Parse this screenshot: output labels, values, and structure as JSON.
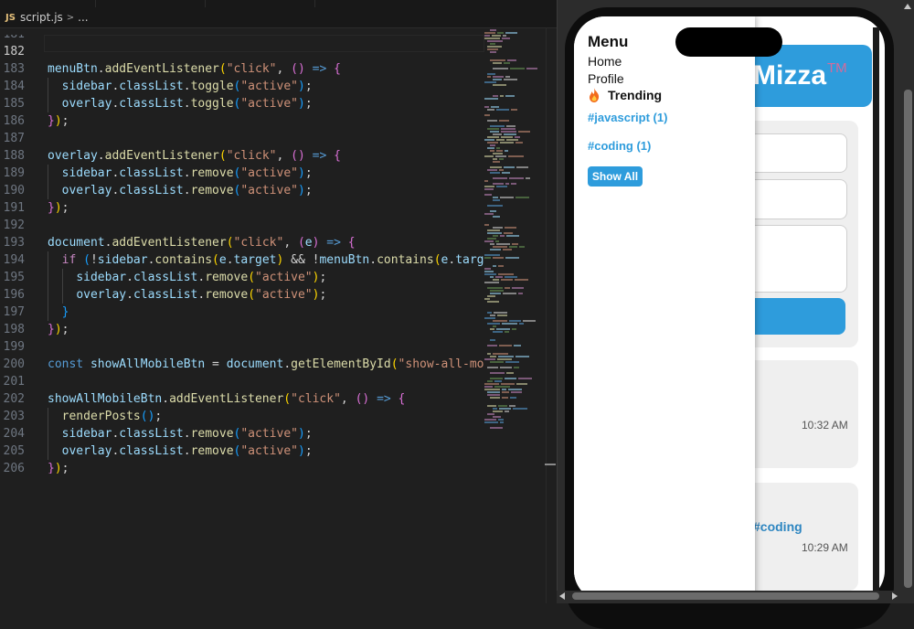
{
  "editor": {
    "file_badge": "JS",
    "file_name": "script.js",
    "crumb_sep": ">",
    "crumb_more": "...",
    "current_line": "182",
    "lines": [
      {
        "n": "181",
        "t": []
      },
      {
        "n": "182",
        "t": []
      },
      {
        "n": "183",
        "t": [
          [
            "var",
            "menuBtn"
          ],
          [
            "p",
            "."
          ],
          [
            "fn",
            "addEventListener"
          ],
          [
            "b1",
            "("
          ],
          [
            "str",
            "\"click\""
          ],
          [
            "p",
            ", "
          ],
          [
            "b2",
            "()"
          ],
          [
            "p",
            " "
          ],
          [
            "kw",
            "=>"
          ],
          [
            "p",
            " "
          ],
          [
            "b2",
            "{"
          ]
        ]
      },
      {
        "n": "184",
        "t": [
          [
            "p",
            "  "
          ],
          [
            "var",
            "sidebar"
          ],
          [
            "p",
            "."
          ],
          [
            "var",
            "classList"
          ],
          [
            "p",
            "."
          ],
          [
            "fn",
            "toggle"
          ],
          [
            "b3",
            "("
          ],
          [
            "str",
            "\"active\""
          ],
          [
            "b3",
            ")"
          ],
          [
            "p",
            ";"
          ]
        ]
      },
      {
        "n": "185",
        "t": [
          [
            "p",
            "  "
          ],
          [
            "var",
            "overlay"
          ],
          [
            "p",
            "."
          ],
          [
            "var",
            "classList"
          ],
          [
            "p",
            "."
          ],
          [
            "fn",
            "toggle"
          ],
          [
            "b3",
            "("
          ],
          [
            "str",
            "\"active\""
          ],
          [
            "b3",
            ")"
          ],
          [
            "p",
            ";"
          ]
        ]
      },
      {
        "n": "186",
        "t": [
          [
            "b2",
            "}"
          ],
          [
            "b1",
            ")"
          ],
          [
            "p",
            ";"
          ]
        ]
      },
      {
        "n": "187",
        "t": []
      },
      {
        "n": "188",
        "t": [
          [
            "var",
            "overlay"
          ],
          [
            "p",
            "."
          ],
          [
            "fn",
            "addEventListener"
          ],
          [
            "b1",
            "("
          ],
          [
            "str",
            "\"click\""
          ],
          [
            "p",
            ", "
          ],
          [
            "b2",
            "()"
          ],
          [
            "p",
            " "
          ],
          [
            "kw",
            "=>"
          ],
          [
            "p",
            " "
          ],
          [
            "b2",
            "{"
          ]
        ]
      },
      {
        "n": "189",
        "t": [
          [
            "p",
            "  "
          ],
          [
            "var",
            "sidebar"
          ],
          [
            "p",
            "."
          ],
          [
            "var",
            "classList"
          ],
          [
            "p",
            "."
          ],
          [
            "fn",
            "remove"
          ],
          [
            "b3",
            "("
          ],
          [
            "str",
            "\"active\""
          ],
          [
            "b3",
            ")"
          ],
          [
            "p",
            ";"
          ]
        ]
      },
      {
        "n": "190",
        "t": [
          [
            "p",
            "  "
          ],
          [
            "var",
            "overlay"
          ],
          [
            "p",
            "."
          ],
          [
            "var",
            "classList"
          ],
          [
            "p",
            "."
          ],
          [
            "fn",
            "remove"
          ],
          [
            "b3",
            "("
          ],
          [
            "str",
            "\"active\""
          ],
          [
            "b3",
            ")"
          ],
          [
            "p",
            ";"
          ]
        ]
      },
      {
        "n": "191",
        "t": [
          [
            "b2",
            "}"
          ],
          [
            "b1",
            ")"
          ],
          [
            "p",
            ";"
          ]
        ]
      },
      {
        "n": "192",
        "t": []
      },
      {
        "n": "193",
        "t": [
          [
            "var",
            "document"
          ],
          [
            "p",
            "."
          ],
          [
            "fn",
            "addEventListener"
          ],
          [
            "b1",
            "("
          ],
          [
            "str",
            "\"click\""
          ],
          [
            "p",
            ", "
          ],
          [
            "b2",
            "("
          ],
          [
            "var",
            "e"
          ],
          [
            "b2",
            ")"
          ],
          [
            "p",
            " "
          ],
          [
            "kw",
            "=>"
          ],
          [
            "p",
            " "
          ],
          [
            "b2",
            "{"
          ]
        ]
      },
      {
        "n": "194",
        "t": [
          [
            "p",
            "  "
          ],
          [
            "ctl",
            "if"
          ],
          [
            "p",
            " "
          ],
          [
            "b3",
            "("
          ],
          [
            "p",
            "!"
          ],
          [
            "var",
            "sidebar"
          ],
          [
            "p",
            "."
          ],
          [
            "fn",
            "contains"
          ],
          [
            "b1",
            "("
          ],
          [
            "var",
            "e"
          ],
          [
            "p",
            "."
          ],
          [
            "var",
            "target"
          ],
          [
            "b1",
            ")"
          ],
          [
            "p",
            " && !"
          ],
          [
            "var",
            "menuBtn"
          ],
          [
            "p",
            "."
          ],
          [
            "fn",
            "contains"
          ],
          [
            "b1",
            "("
          ],
          [
            "var",
            "e"
          ],
          [
            "p",
            "."
          ],
          [
            "var",
            "targe"
          ]
        ]
      },
      {
        "n": "195",
        "t": [
          [
            "p",
            "    "
          ],
          [
            "var",
            "sidebar"
          ],
          [
            "p",
            "."
          ],
          [
            "var",
            "classList"
          ],
          [
            "p",
            "."
          ],
          [
            "fn",
            "remove"
          ],
          [
            "b1",
            "("
          ],
          [
            "str",
            "\"active\""
          ],
          [
            "b1",
            ")"
          ],
          [
            "p",
            ";"
          ]
        ]
      },
      {
        "n": "196",
        "t": [
          [
            "p",
            "    "
          ],
          [
            "var",
            "overlay"
          ],
          [
            "p",
            "."
          ],
          [
            "var",
            "classList"
          ],
          [
            "p",
            "."
          ],
          [
            "fn",
            "remove"
          ],
          [
            "b1",
            "("
          ],
          [
            "str",
            "\"active\""
          ],
          [
            "b1",
            ")"
          ],
          [
            "p",
            ";"
          ]
        ]
      },
      {
        "n": "197",
        "t": [
          [
            "p",
            "  "
          ],
          [
            "b3",
            "}"
          ]
        ]
      },
      {
        "n": "198",
        "t": [
          [
            "b2",
            "}"
          ],
          [
            "b1",
            ")"
          ],
          [
            "p",
            ";"
          ]
        ]
      },
      {
        "n": "199",
        "t": []
      },
      {
        "n": "200",
        "t": [
          [
            "kw",
            "const"
          ],
          [
            "p",
            " "
          ],
          [
            "var",
            "showAllMobileBtn"
          ],
          [
            "p",
            " = "
          ],
          [
            "var",
            "document"
          ],
          [
            "p",
            "."
          ],
          [
            "fn",
            "getElementById"
          ],
          [
            "b1",
            "("
          ],
          [
            "str",
            "\"show-all-mob"
          ]
        ]
      },
      {
        "n": "201",
        "t": []
      },
      {
        "n": "202",
        "t": [
          [
            "var",
            "showAllMobileBtn"
          ],
          [
            "p",
            "."
          ],
          [
            "fn",
            "addEventListener"
          ],
          [
            "b1",
            "("
          ],
          [
            "str",
            "\"click\""
          ],
          [
            "p",
            ", "
          ],
          [
            "b2",
            "()"
          ],
          [
            "p",
            " "
          ],
          [
            "kw",
            "=>"
          ],
          [
            "p",
            " "
          ],
          [
            "b2",
            "{"
          ]
        ]
      },
      {
        "n": "203",
        "t": [
          [
            "p",
            "  "
          ],
          [
            "fn",
            "renderPosts"
          ],
          [
            "b3",
            "()"
          ],
          [
            "p",
            ";"
          ]
        ]
      },
      {
        "n": "204",
        "t": [
          [
            "p",
            "  "
          ],
          [
            "var",
            "sidebar"
          ],
          [
            "p",
            "."
          ],
          [
            "var",
            "classList"
          ],
          [
            "p",
            "."
          ],
          [
            "fn",
            "remove"
          ],
          [
            "b3",
            "("
          ],
          [
            "str",
            "\"active\""
          ],
          [
            "b3",
            ")"
          ],
          [
            "p",
            ";"
          ]
        ]
      },
      {
        "n": "205",
        "t": [
          [
            "p",
            "  "
          ],
          [
            "var",
            "overlay"
          ],
          [
            "p",
            "."
          ],
          [
            "var",
            "classList"
          ],
          [
            "p",
            "."
          ],
          [
            "fn",
            "remove"
          ],
          [
            "b3",
            "("
          ],
          [
            "str",
            "\"active\""
          ],
          [
            "b3",
            ")"
          ],
          [
            "p",
            ";"
          ]
        ]
      },
      {
        "n": "206",
        "t": [
          [
            "b2",
            "}"
          ],
          [
            "b1",
            ")"
          ],
          [
            "p",
            ";"
          ]
        ]
      }
    ]
  },
  "preview": {
    "sidebar": {
      "title": "Menu",
      "items": [
        "Home",
        "Profile"
      ],
      "trending_label": "Trending",
      "tags": [
        "#javascript (1)",
        "#coding (1)"
      ],
      "show_all_label": "Show All"
    },
    "app": {
      "brand_text": "Mizza",
      "brand_mark": "TM",
      "card1_time": "10:32 AM",
      "card2_tag": "#coding",
      "card2_time": "10:29 AM"
    }
  },
  "colors": {
    "accent": "#2e9cdc",
    "editor_bg": "#1f1f1f",
    "string": "#ce9178",
    "function": "#dcdcaa",
    "variable": "#9cdcfe"
  }
}
